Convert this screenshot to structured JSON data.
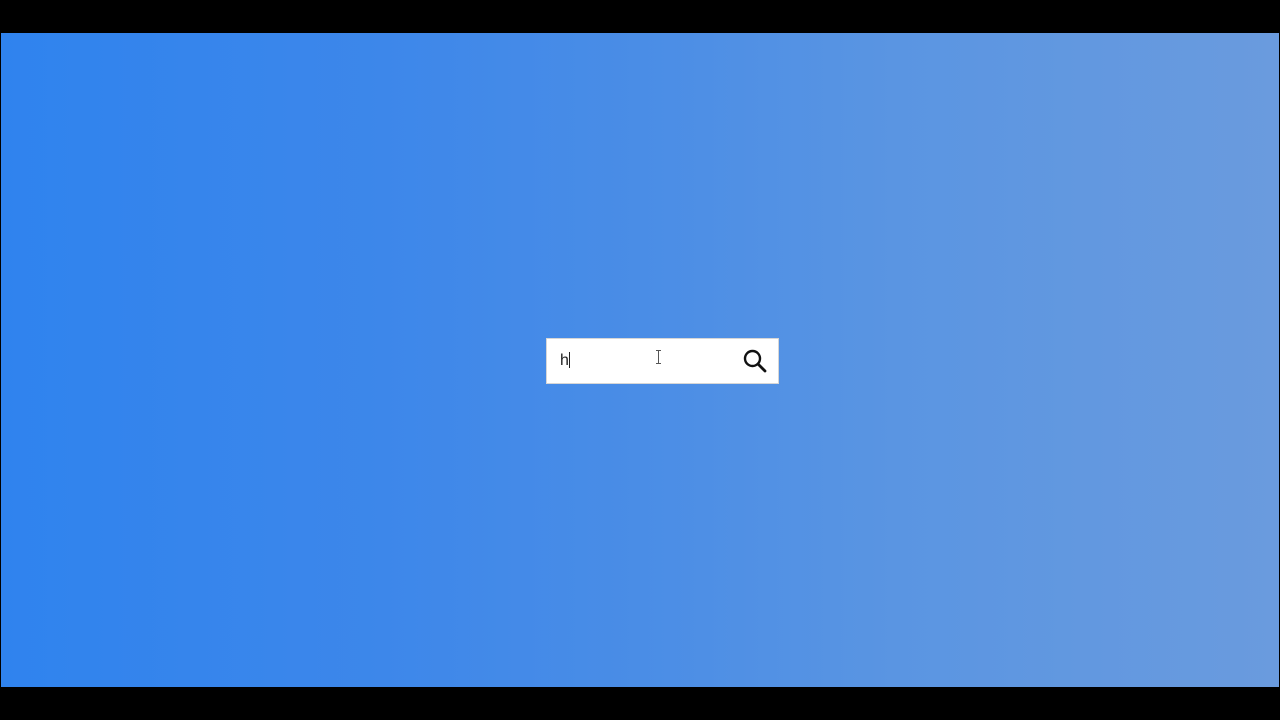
{
  "search": {
    "value": "h",
    "placeholder": "",
    "button_icon": "search-icon"
  },
  "colors": {
    "background_start": "#2f83ee",
    "background_end": "#6a9bde",
    "search_box": "#ffffff",
    "icon": "#111111"
  }
}
